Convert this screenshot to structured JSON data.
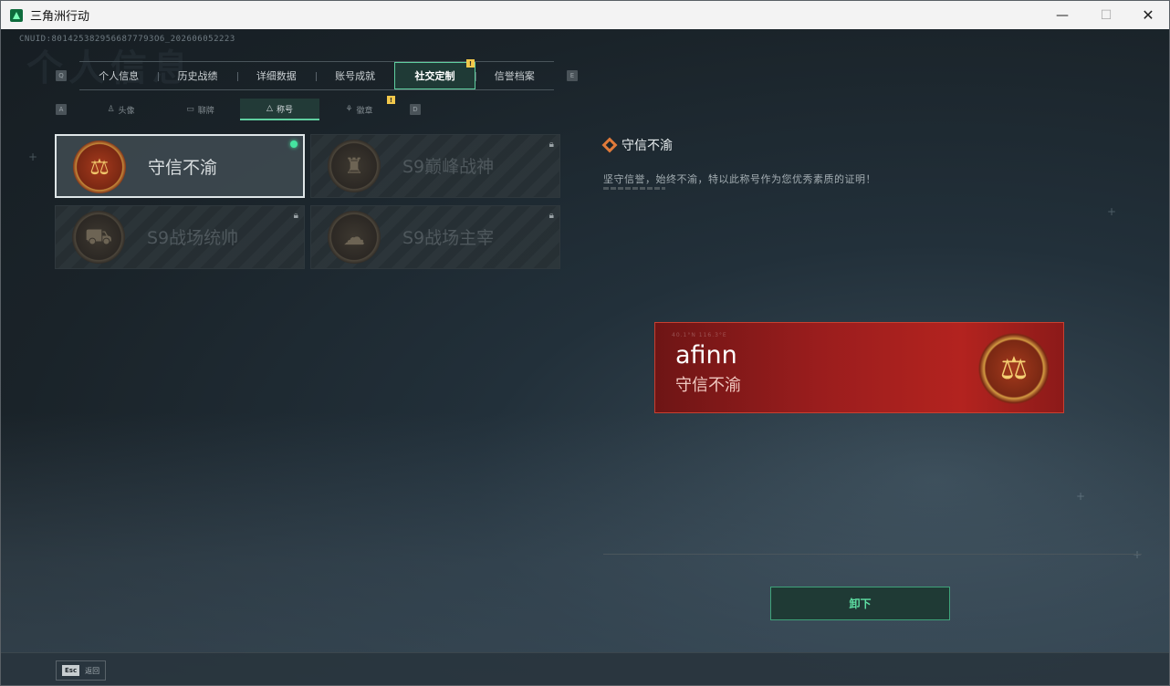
{
  "window": {
    "title": "三角洲行动",
    "min_label": "—",
    "max_label": "☐",
    "close_label": "✕"
  },
  "header": {
    "cnuid": "CNUID:8014253829566877793O6_202606052223",
    "bg_title": "个人信息"
  },
  "tabs": {
    "prev_key": "Q",
    "next_key": "E",
    "items": [
      {
        "label": "个人信息"
      },
      {
        "label": "历史战绩"
      },
      {
        "label": "详细数据"
      },
      {
        "label": "账号成就"
      },
      {
        "label": "社交定制"
      },
      {
        "label": "信誉档案"
      }
    ],
    "active_index": 4,
    "badge": "!"
  },
  "subtabs": {
    "prev_key": "A",
    "next_key": "D",
    "items": [
      {
        "label": "头像",
        "icon": "person-icon"
      },
      {
        "label": "聊牌",
        "icon": "card-icon"
      },
      {
        "label": "称号",
        "icon": "triangle-icon"
      },
      {
        "label": "徽章",
        "icon": "emblem-icon"
      }
    ],
    "active_index": 2,
    "badge": "!"
  },
  "titles": [
    {
      "name": "守信不渝",
      "locked": false,
      "equipped": true,
      "medal": "scales-medal"
    },
    {
      "name": "S9巅峰战神",
      "locked": true,
      "equipped": false,
      "medal": "castle-medal"
    },
    {
      "name": "S9战场统帅",
      "locked": true,
      "equipped": false,
      "medal": "tank-medal"
    },
    {
      "name": "S9战场主宰",
      "locked": true,
      "equipped": false,
      "medal": "explosion-medal"
    }
  ],
  "detail": {
    "title": "守信不渝",
    "description": "坚守信誉，始终不渝，特以此称号作为您优秀素质的证明！"
  },
  "banner": {
    "username": "afinn",
    "title": "守信不渝",
    "deco_text": "40.1°N  116.3°E"
  },
  "actions": {
    "unequip_label": "卸下"
  },
  "footer": {
    "esc_key": "Esc",
    "esc_label": "返回"
  },
  "colors": {
    "accent": "#5fcfa0",
    "badge": "#f2c84b",
    "banner_red": "#9a1d1d"
  }
}
